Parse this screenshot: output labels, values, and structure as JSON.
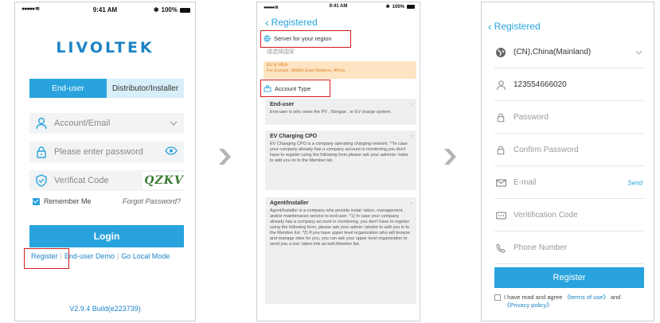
{
  "colors": {
    "accent": "#29a3dd",
    "brand": "#1c84c6",
    "highlight": "#d01b1b",
    "region_bg": "#fde4c2"
  },
  "status_bar": {
    "time": "9:41 AM",
    "battery": "100%"
  },
  "login": {
    "logo": "LIVOLTEK",
    "tabs": [
      "End-user",
      "Distributor/Installer"
    ],
    "account_placeholder": "Account/Email",
    "password_placeholder": "Please enter password",
    "verify_placeholder": "Verificat Code",
    "captcha": "QZKV",
    "remember": "Remember Me",
    "forgot": "Forgot Password?",
    "login_button": "Login",
    "link_register": "Register",
    "link_demo": "End-user Demo",
    "link_local": "Go Local Mode",
    "version": "V2.9.4 Build(e223739)"
  },
  "registered": {
    "back_title": "Registered",
    "server_heading": "Server for your region",
    "server_select": "请选择国家",
    "region_line1": "EU & MEA",
    "region_line2": "For Europe, Middle East Regions, Africa.",
    "account_type": "Account Type",
    "cards": [
      {
        "title": "End-user",
        "desc": "End-user is who owns the PV , Storgae , or EV charge system."
      },
      {
        "title": "EV Charging CPO",
        "desc": "EV Changing CPO is a company operating charging network. **In case your company already has a company account in monitoring,you don't have to register using the following form,please ask your adminis- trator to add you ini to the Member list."
      },
      {
        "title": "Agent/Installer",
        "desc": "Agent/Installer is a company who provide instal- lation, management, and/or maintenance service to end-user. *1) In case your company already has a company account in monitoring, you don't have to register using the following form, please ask your admin- istrator to add you in to the Member list. *2) If you have upper level organization who will browse and manage sites for you, you can ask your upper level organization to send you a invi- tation link as well.Member list."
      }
    ]
  },
  "register_form": {
    "back_title": "Registered",
    "country": "(CN),China(Mainland)",
    "phone_value": "123554666020",
    "password": "Password",
    "confirm_password": "Confirm Password",
    "email": "E-mail",
    "send": "Send",
    "verification": "Veritification Code",
    "phone_number": "Phone Number",
    "register_button": "Register",
    "agree_prefix": "I have read and agree",
    "terms": "《terms of use》",
    "and": "and",
    "privacy": "《Privacy policy》"
  }
}
